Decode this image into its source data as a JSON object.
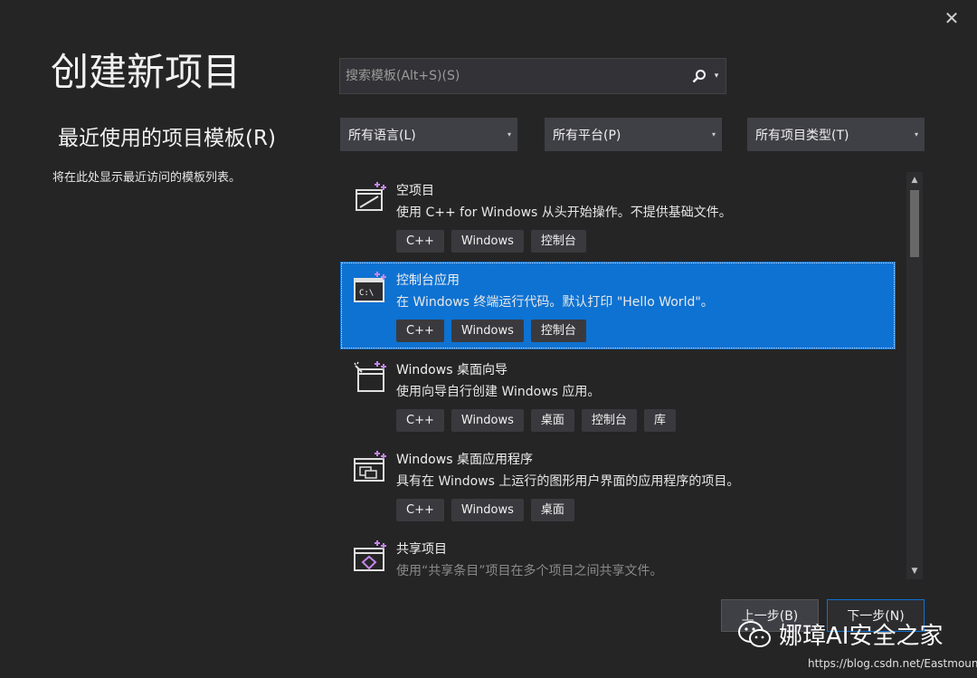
{
  "window": {
    "close_glyph": "✕"
  },
  "page": {
    "title": "创建新项目"
  },
  "recent": {
    "heading": "最近使用的项目模板(R)",
    "empty_text": "将在此处显示最近访问的模板列表。"
  },
  "search": {
    "placeholder": "搜索模板(Alt+S)(S)",
    "value": "",
    "icon": "search-icon",
    "dropdown_glyph": "▾"
  },
  "filters": {
    "language": "所有语言(L)",
    "platform": "所有平台(P)",
    "project_type": "所有项目类型(T)",
    "arrow_glyph": "▾"
  },
  "templates": [
    {
      "name": "空项目",
      "description": "使用 C++ for Windows 从头开始操作。不提供基础文件。",
      "tags": [
        "C++",
        "Windows",
        "控制台"
      ],
      "icon": "empty-project-icon",
      "selected": false
    },
    {
      "name": "控制台应用",
      "description": "在 Windows 终端运行代码。默认打印 \"Hello World\"。",
      "tags": [
        "C++",
        "Windows",
        "控制台"
      ],
      "icon": "console-app-icon",
      "icon_text": "C:\\",
      "selected": true
    },
    {
      "name": "Windows 桌面向导",
      "description": "使用向导自行创建 Windows 应用。",
      "tags": [
        "C++",
        "Windows",
        "桌面",
        "控制台",
        "库"
      ],
      "icon": "desktop-wizard-icon",
      "selected": false
    },
    {
      "name": "Windows 桌面应用程序",
      "description": "具有在 Windows 上运行的图形用户界面的应用程序的项目。",
      "tags": [
        "C++",
        "Windows",
        "桌面"
      ],
      "icon": "desktop-app-icon",
      "selected": false
    },
    {
      "name": "共享项目",
      "description": "使用“共享条目”项目在多个项目之间共享文件。",
      "tags": [],
      "icon": "shared-project-icon",
      "selected": false
    }
  ],
  "scrollbar": {
    "up_glyph": "▲",
    "down_glyph": "▼"
  },
  "buttons": {
    "back": "上一步(B)",
    "next": "下一步(N)"
  },
  "watermark": {
    "text": "娜璋AI安全之家",
    "url": "https://blog.csdn.net/Eastmount"
  },
  "colors": {
    "background": "#252526",
    "selection": "#0e72d2",
    "accent_plus": "#c586e6"
  }
}
